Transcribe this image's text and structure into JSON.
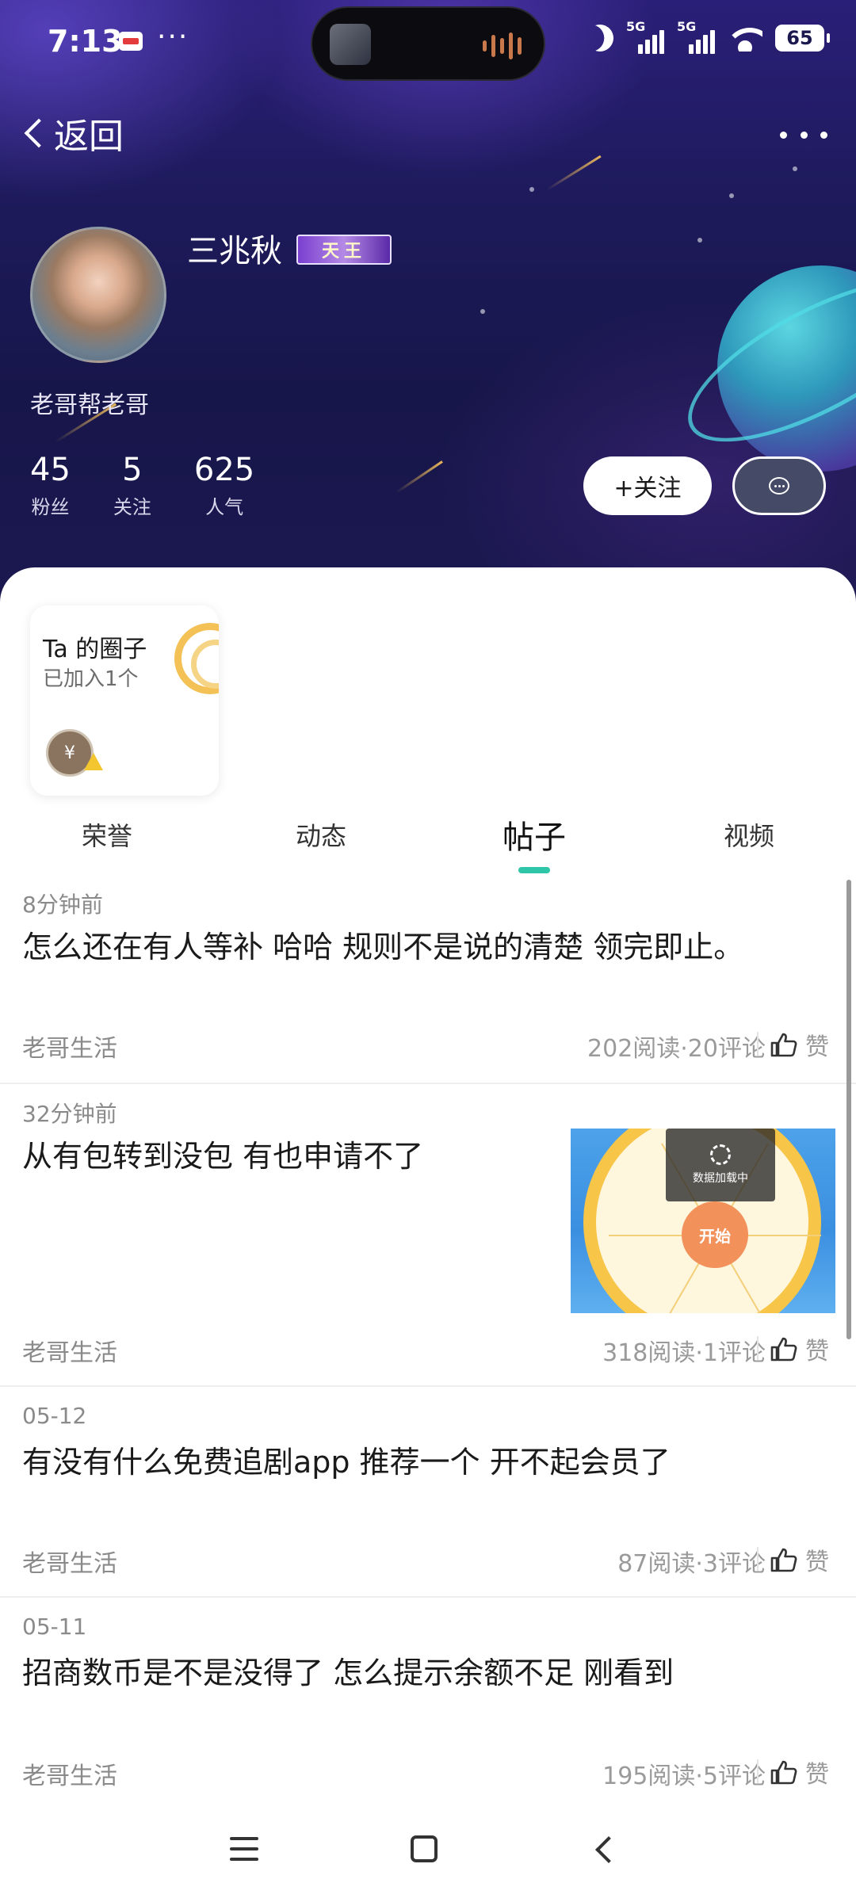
{
  "status_bar": {
    "time": "7:13",
    "dots": "···",
    "network_1": "5G",
    "network_2": "5G",
    "battery": "65"
  },
  "header": {
    "back_label": "返回"
  },
  "profile": {
    "name": "三兆秋",
    "badge_text": "天王",
    "tagline": "老哥帮老哥",
    "stats": [
      {
        "value": "45",
        "label": "粉丝"
      },
      {
        "value": "5",
        "label": "关注"
      },
      {
        "value": "625",
        "label": "人气"
      }
    ],
    "follow_label": "+关注"
  },
  "circle_card": {
    "title": "Ta 的圈子",
    "subtitle": "已加入1个",
    "icon_glyph": "¥"
  },
  "tabs": [
    {
      "label": "荣誉",
      "active": false
    },
    {
      "label": "动态",
      "active": false
    },
    {
      "label": "帖子",
      "active": true
    },
    {
      "label": "视频",
      "active": false
    }
  ],
  "posts": [
    {
      "time": "8分钟前",
      "text": "怎么还在有人等补 哈哈  规则不是说的清楚 领完即止。",
      "source": "老哥生活",
      "stats": "202阅读·20评论",
      "like": "赞"
    },
    {
      "time": "32分钟前",
      "text": "从有包转到没包   有也申请不了",
      "source": "老哥生活",
      "stats": "318阅读·1评论",
      "like": "赞",
      "image": {
        "loading_text": "数据加载中",
        "wheel_button": "开始"
      }
    },
    {
      "time": "05-12",
      "text": "有没有什么免费追剧app  推荐一个  开不起会员了",
      "source": "老哥生活",
      "stats": "87阅读·3评论",
      "like": "赞"
    },
    {
      "time": "05-11",
      "text": "招商数币是不是没得了  怎么提示余额不足   刚看到",
      "source": "老哥生活",
      "stats": "195阅读·5评论",
      "like": "赞"
    }
  ],
  "colors": {
    "accent": "#2fc5a8",
    "hero_bg": "#1d1a5a"
  }
}
